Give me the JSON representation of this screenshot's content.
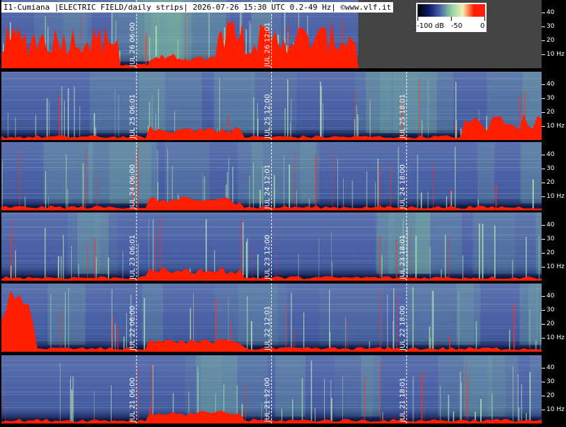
{
  "header": {
    "title": "I1-Cumiana |ELECTRIC FIELD/daily strips| 2026-07-26 15:30 UTC 0.2-49 Hz| ©www.vlf.it"
  },
  "colorbar": {
    "unit_label": "-100 dB",
    "mid_label": "-50",
    "max_label": "0",
    "colors": [
      "#000000",
      "#0a1a6a",
      "#4a63a8",
      "#8fd0a0",
      "#f2f0b0",
      "#ff2000",
      "#ff1a10"
    ]
  },
  "chart_data": {
    "type": "heatmap",
    "title": "I1-Cumiana |ELECTRIC FIELD/daily strips| 2026-07-26 15:30 UTC 0.2-49 Hz| ©www.vlf.it",
    "y_unit": "Hz",
    "y_range": [
      0,
      49
    ],
    "y_ticks": [
      {
        "value": 10,
        "label": "10 Hz"
      },
      {
        "value": 20,
        "label": "20"
      },
      {
        "value": 30,
        "label": "30"
      },
      {
        "value": 40,
        "label": "40"
      }
    ],
    "color_scale": {
      "min_db": -100,
      "max_db": 0,
      "labels": [
        "-100 dB",
        "-50",
        "0"
      ]
    },
    "strips": [
      {
        "date": "JUL 26",
        "end_fraction": 0.66,
        "markers": [
          {
            "hour": 6,
            "label": "06:00"
          },
          {
            "hour": 12,
            "label": "12:01"
          }
        ]
      },
      {
        "date": "JUL 25",
        "end_fraction": 1.0,
        "markers": [
          {
            "hour": 6,
            "label": "06:01"
          },
          {
            "hour": 12,
            "label": "12:00"
          },
          {
            "hour": 18,
            "label": "18:01"
          }
        ]
      },
      {
        "date": "JUL 24",
        "end_fraction": 1.0,
        "markers": [
          {
            "hour": 6,
            "label": "06:00"
          },
          {
            "hour": 12,
            "label": "12:01"
          },
          {
            "hour": 18,
            "label": "18:00"
          }
        ]
      },
      {
        "date": "JUL 23",
        "end_fraction": 1.0,
        "markers": [
          {
            "hour": 6,
            "label": "06:01"
          },
          {
            "hour": 12,
            "label": "12:00"
          },
          {
            "hour": 18,
            "label": "18:01"
          }
        ]
      },
      {
        "date": "JUL 22",
        "end_fraction": 1.0,
        "markers": [
          {
            "hour": 6,
            "label": "06:00"
          },
          {
            "hour": 12,
            "label": "12:01"
          },
          {
            "hour": 18,
            "label": "18:00"
          }
        ]
      },
      {
        "date": "JUL 21",
        "end_fraction": 1.0,
        "markers": [
          {
            "hour": 6,
            "label": "06:00"
          },
          {
            "hour": 12,
            "label": "12:00"
          },
          {
            "hour": 18,
            "label": "18:01"
          }
        ]
      }
    ]
  }
}
